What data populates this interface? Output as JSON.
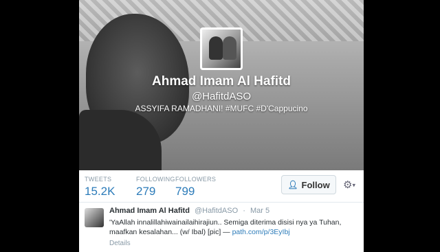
{
  "profile": {
    "name": "Ahmad Imam Al Hafitd",
    "handle": "@HafitdASO",
    "bio": "ASSYIFA RAMADHANI! #MUFC #D'Cappucino"
  },
  "stats": [
    {
      "label": "TWEETS",
      "value": "15.2K"
    },
    {
      "label": "FOLLOWING",
      "value": "279"
    },
    {
      "label": "FOLLOWERS",
      "value": "799"
    }
  ],
  "actions": {
    "follow_label": "Follow",
    "follow_icon": "add-user-icon",
    "settings_icon": "gear-icon"
  },
  "tweet": {
    "name": "Ahmad Imam Al Hafitd",
    "handle": "@HafitdASO",
    "separator": "·",
    "date": "Mar 5",
    "text_part1": "'YaAllah innalillahiwainailaihirajiun.. Semiga diterima disisi nya ya Tuhan, maafkan kesalahan... (w/ Ibal) [pic] — ",
    "link": "path.com/p/3EyIbj",
    "details": "Details"
  },
  "colors": {
    "accent": "#2b7bb9",
    "muted": "#8899a6"
  }
}
